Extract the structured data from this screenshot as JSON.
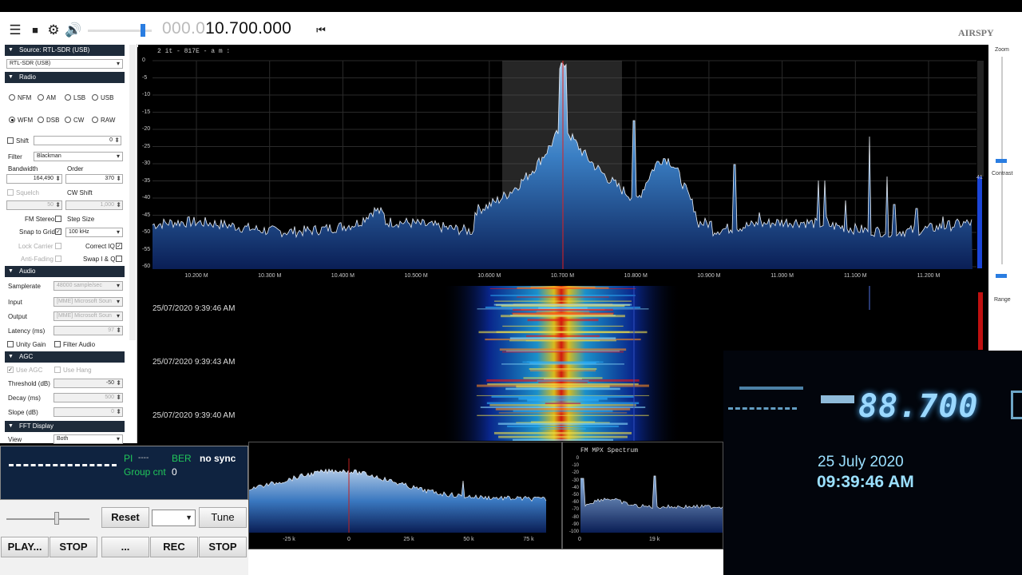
{
  "toolbar": {
    "frequency_dim": "000.0",
    "frequency_main": "10.700.000",
    "brand": "AIRSPY"
  },
  "left_panel": {
    "source_header": "Source: RTL-SDR (USB)",
    "source_select": "RTL-SDR (USB)",
    "radio_header": "Radio",
    "modes": [
      "NFM",
      "AM",
      "LSB",
      "USB",
      "WFM",
      "DSB",
      "CW",
      "RAW"
    ],
    "selected_mode": "WFM",
    "shift_label": "Shift",
    "shift_value": "0",
    "filter_label": "Filter",
    "filter_value": "Blackman",
    "bandwidth_label": "Bandwidth",
    "bandwidth_value": "164,490",
    "order_label": "Order",
    "order_value": "370",
    "squelch_label": "Squelch",
    "squelch_value": "50",
    "cw_shift_label": "CW Shift",
    "cw_shift_value": "1,000",
    "fm_stereo_label": "FM Stereo",
    "step_size_label": "Step Size",
    "snap_label": "Snap to Grid",
    "snap_value": "100 kHz",
    "lock_carrier_label": "Lock Carrier",
    "correct_iq_label": "Correct IQ",
    "anti_fading_label": "Anti-Fading",
    "swap_iq_label": "Swap I & Q",
    "audio_header": "Audio",
    "samplerate_label": "Samplerate",
    "samplerate_value": "48000 sample/sec",
    "input_label": "Input",
    "input_value": "[MME] Microsoft Soun",
    "output_label": "Output",
    "output_value": "[MME] Microsoft Soun",
    "latency_label": "Latency (ms)",
    "latency_value": "97",
    "unity_gain_label": "Unity Gain",
    "filter_audio_label": "Filter Audio",
    "agc_header": "AGC",
    "use_agc_label": "Use AGC",
    "use_hang_label": "Use Hang",
    "threshold_label": "Threshold (dB)",
    "threshold_value": "-50",
    "decay_label": "Decay (ms)",
    "decay_value": "500",
    "slope_label": "Slope (dB)",
    "slope_value": "0",
    "fft_header": "FFT Display",
    "view_label": "View",
    "view_value": "Both"
  },
  "spectrum": {
    "header": "2  it   - 817E -      a      m :",
    "y_ticks": [
      "0",
      "-5",
      "-10",
      "-15",
      "-20",
      "-25",
      "-30",
      "-35",
      "-40",
      "-45",
      "-50",
      "-55",
      "-60"
    ],
    "x_ticks": [
      "10.200 M",
      "10.300 M",
      "10.400 M",
      "10.500 M",
      "10.600 M",
      "10.700 M",
      "10.800 M",
      "10.900 M",
      "11.000 M",
      "11.100 M",
      "11.200 M"
    ],
    "right_value": "41"
  },
  "waterfall": {
    "timestamps": [
      "25/07/2020 9:39:46 AM",
      "25/07/2020 9:39:43 AM",
      "25/07/2020 9:39:40 AM"
    ]
  },
  "right_strip": {
    "zoom_label": "Zoom",
    "contrast_label": "Contrast",
    "range_label": "Range"
  },
  "rds": {
    "pi_label": "PI",
    "pi_value": "----",
    "ber_label": "BER",
    "sync_text": "no sync",
    "group_cnt_label": "Group cnt",
    "group_cnt_value": "0"
  },
  "controls": {
    "reset_label": "Reset",
    "tune_label": "Tune",
    "play_label": "PLAY...",
    "stop1_label": "STOP",
    "ellipsis_label": "...",
    "rec_label": "REC",
    "stop2_label": "STOP"
  },
  "audio_spectrum": {
    "x_ticks": [
      "-25 k",
      "0",
      "25 k",
      "50 k",
      "75 k"
    ]
  },
  "mpx": {
    "title": "FM MPX Spectrum",
    "y_ticks": [
      "0",
      "-10",
      "-20",
      "-30",
      "-40",
      "-50",
      "-60",
      "-70",
      "-80",
      "-90",
      "-100"
    ],
    "x_ticks": [
      "0",
      "19 k"
    ]
  },
  "overlay": {
    "lcd_text": "88.700",
    "date": "25 July 2020",
    "time": "09:39:46 AM"
  }
}
